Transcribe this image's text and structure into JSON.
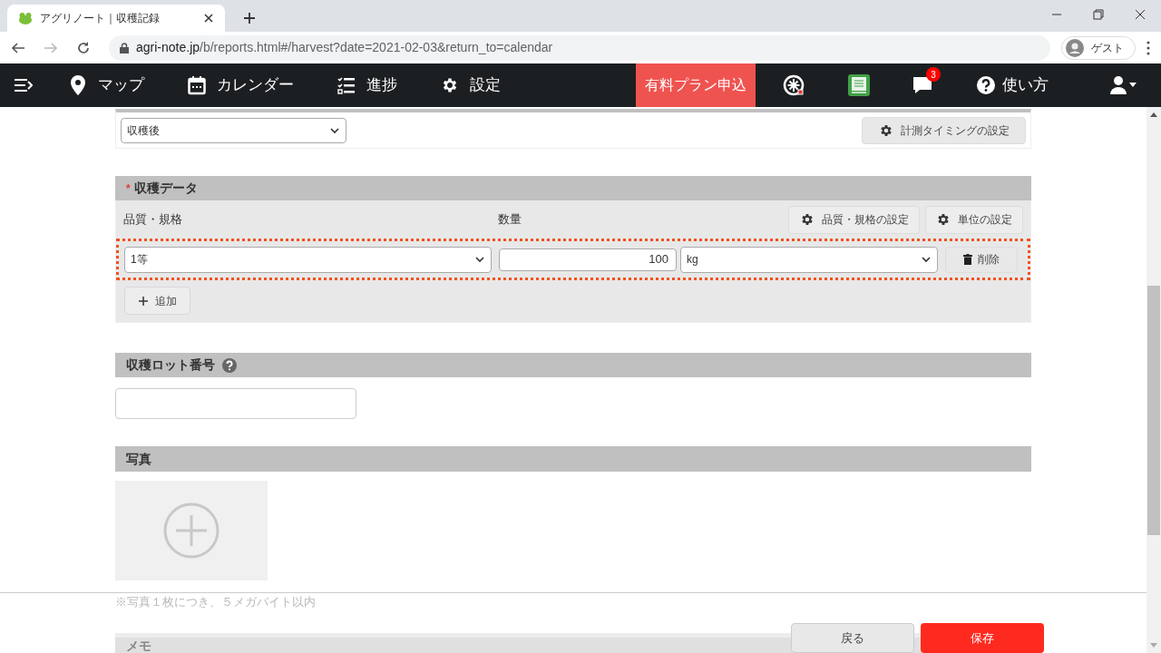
{
  "browser": {
    "tab_title": "アグリノート｜収穫記録",
    "url_host": "agri-note.jp",
    "url_path": "/b/reports.html#/harvest?date=2021-02-03&return_to=calendar",
    "profile": "ゲスト"
  },
  "nav": {
    "items": [
      {
        "kind": "map",
        "label": "マップ"
      },
      {
        "kind": "calendar",
        "label": "カレンダー"
      },
      {
        "kind": "progress",
        "label": "進捗"
      },
      {
        "kind": "settings",
        "label": "設定"
      }
    ],
    "plan_button": "有料プラン申込",
    "notification_count": "3",
    "help": "使い方"
  },
  "timing": {
    "select": "収穫後",
    "button": "計測タイミングの設定"
  },
  "harvest_data": {
    "title": "収穫データ",
    "required_mark": "*",
    "columns": [
      "品質・規格",
      "数量"
    ],
    "buttons": [
      "品質・規格の設定",
      "単位の設定"
    ],
    "rows": [
      {
        "grade": "1等",
        "quantity": "100",
        "unit": "kg",
        "delete": "削除",
        "highlighted": true
      }
    ],
    "add_button": "追加"
  },
  "lot": {
    "title": "収穫ロット番号"
  },
  "photo": {
    "title": "写真",
    "note": "※写真１枚につき、５メガバイト以内"
  },
  "memo": {
    "title": "メモ"
  },
  "footer": {
    "back": "戻る",
    "save": "保存"
  }
}
